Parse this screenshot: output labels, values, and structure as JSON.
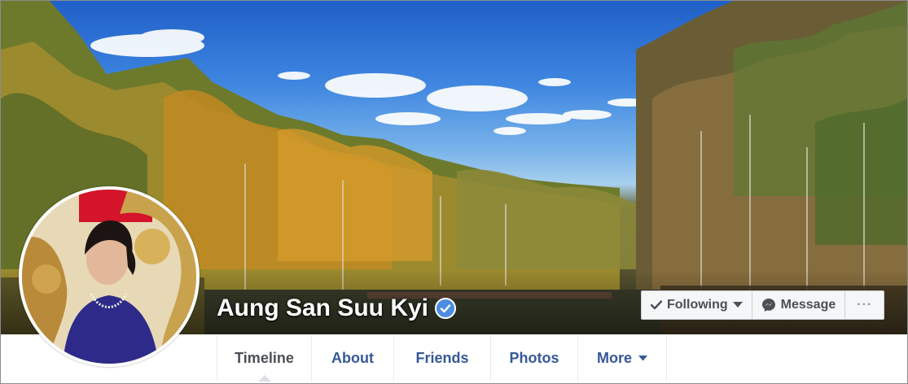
{
  "profile": {
    "name": "Aung San Suu Kyi",
    "verified": true
  },
  "actions": {
    "following_label": "Following",
    "message_label": "Message",
    "more_label": "···"
  },
  "tabs": [
    {
      "label": "Timeline",
      "active": true
    },
    {
      "label": "About",
      "active": false
    },
    {
      "label": "Friends",
      "active": false
    },
    {
      "label": "Photos",
      "active": false
    },
    {
      "label": "More",
      "active": false
    }
  ],
  "icons": {
    "verified": "verified-badge-icon",
    "following": "checkmark-icon",
    "message": "messenger-icon",
    "more_caret": "caret-down-icon"
  },
  "colors": {
    "link_blue": "#365899",
    "verified_blue": "#4b8de0",
    "tab_text": "#4b4f56"
  }
}
